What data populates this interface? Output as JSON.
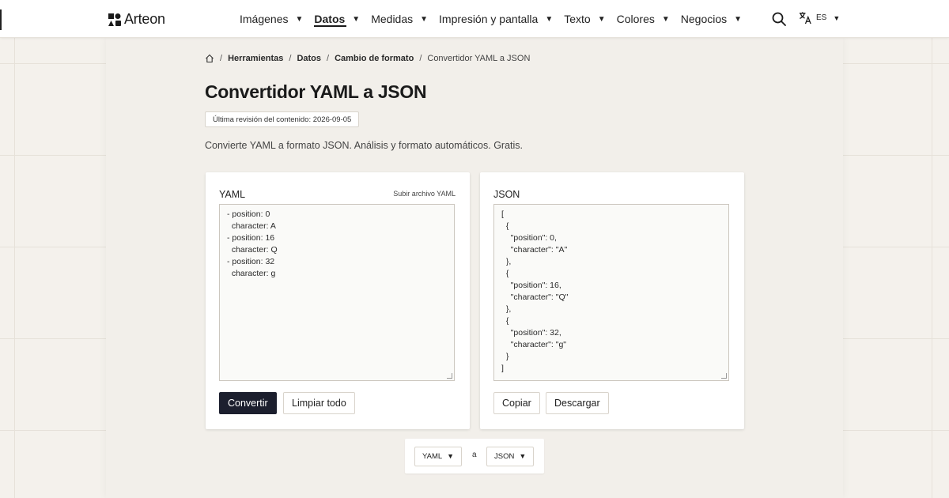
{
  "brand": {
    "name": "Arteon"
  },
  "nav": {
    "items": [
      {
        "label": "Imágenes"
      },
      {
        "label": "Datos"
      },
      {
        "label": "Medidas"
      },
      {
        "label": "Impresión y pantalla"
      },
      {
        "label": "Texto"
      },
      {
        "label": "Colores"
      },
      {
        "label": "Negocios"
      }
    ],
    "active_index": 1,
    "language": "ES"
  },
  "breadcrumb": [
    "Herramientas",
    "Datos",
    "Cambio de formato",
    "Convertidor YAML a JSON"
  ],
  "page": {
    "title": "Convertidor YAML a JSON",
    "revision": "Última revisión del contenido: 2026-09-05",
    "subtitle": "Convierte YAML a formato JSON. Análisis y formato automáticos. Gratis."
  },
  "input_panel": {
    "label": "YAML",
    "upload_link": "Subir archivo YAML",
    "content": "- position: 0\n  character: A\n- position: 16\n  character: Q\n- position: 32\n  character: g",
    "convert_label": "Convertir",
    "clear_label": "Limpiar todo"
  },
  "output_panel": {
    "label": "JSON",
    "content": "[\n  {\n    \"position\": 0,\n    \"character\": \"A\"\n  },\n  {\n    \"position\": 16,\n    \"character\": \"Q\"\n  },\n  {\n    \"position\": 32,\n    \"character\": \"g\"\n  }\n]",
    "copy_label": "Copiar",
    "download_label": "Descargar"
  },
  "format_bar": {
    "from": "YAML",
    "to_word": "a",
    "to": "JSON"
  },
  "colors": {
    "background": "#f4f1ec",
    "primary_button": "#1c1f2e",
    "text": "#1f1f1f"
  },
  "icons": [
    "arteon-logo-icon",
    "search-icon",
    "translate-icon",
    "home-icon",
    "caret-down-icon"
  ]
}
